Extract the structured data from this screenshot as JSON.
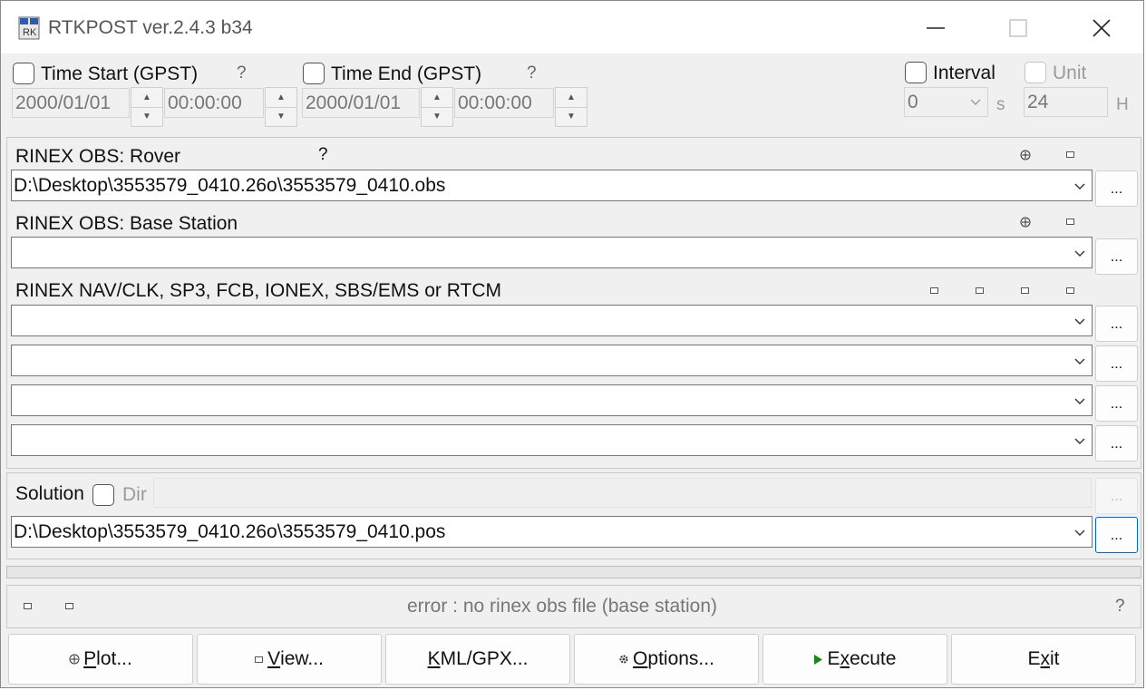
{
  "window": {
    "title": "RTKPOST ver.2.4.3 b34"
  },
  "time_start": {
    "label": "Time Start (GPST)",
    "help": "?",
    "date": "2000/01/01",
    "time": "00:00:00"
  },
  "time_end": {
    "label": "Time End (GPST)",
    "help": "?",
    "date": "2000/01/01",
    "time": "00:00:00"
  },
  "interval": {
    "label": "Interval",
    "value": "0",
    "unit": "s"
  },
  "unit": {
    "label": "Unit",
    "value": "24",
    "suffix": "H"
  },
  "rover": {
    "label": "RINEX OBS: Rover",
    "help": "?",
    "value": "D:\\Desktop\\3553579_0410.26o\\3553579_0410.obs",
    "browse": "..."
  },
  "base": {
    "label": "RINEX OBS: Base Station",
    "value": "",
    "browse": "..."
  },
  "nav": {
    "label": "RINEX NAV/CLK, SP3, FCB, IONEX, SBS/EMS  or RTCM",
    "browse": "..."
  },
  "solution": {
    "label": "Solution",
    "dir_label": "Dir",
    "value": "D:\\Desktop\\3553579_0410.26o\\3553579_0410.pos",
    "browse": "...",
    "dir_browse": "..."
  },
  "status": {
    "message": "error : no rinex obs file (base station)",
    "help": "?"
  },
  "buttons": {
    "plot": {
      "mn": "P",
      "rest": "lot..."
    },
    "view": {
      "mn": "V",
      "rest": "iew..."
    },
    "kml": {
      "mn": "K",
      "rest": "ML/GPX..."
    },
    "options": {
      "mn": "O",
      "rest": "ptions..."
    },
    "execute": {
      "pre": "E",
      "mn": "x",
      "rest": "ecute"
    },
    "exit": {
      "pre": "E",
      "mn": "x",
      "rest": "it"
    }
  },
  "icons": {
    "app": "rtklib-app-icon",
    "plot": "plot-icon",
    "view": "view-icon",
    "options": "gear-icon",
    "execute": "play-icon"
  }
}
